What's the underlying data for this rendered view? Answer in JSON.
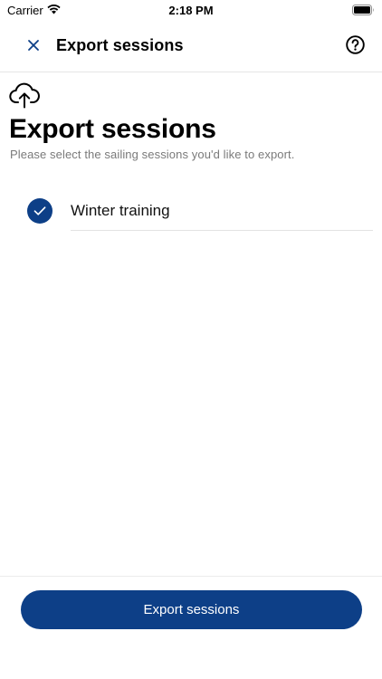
{
  "status_bar": {
    "carrier": "Carrier",
    "time": "2:18 PM"
  },
  "nav": {
    "title": "Export sessions",
    "close_icon": "close-icon",
    "help_icon": "help-icon"
  },
  "header": {
    "icon": "cloud-upload-icon",
    "title": "Export sessions",
    "subtitle": "Please select the sailing sessions you'd like to export."
  },
  "sessions": [
    {
      "label": "Winter training",
      "selected": true
    }
  ],
  "footer": {
    "export_label": "Export sessions"
  },
  "colors": {
    "accent": "#0d3f87",
    "subtitle": "#7a7a7a",
    "divider": "#e3e3e3"
  }
}
